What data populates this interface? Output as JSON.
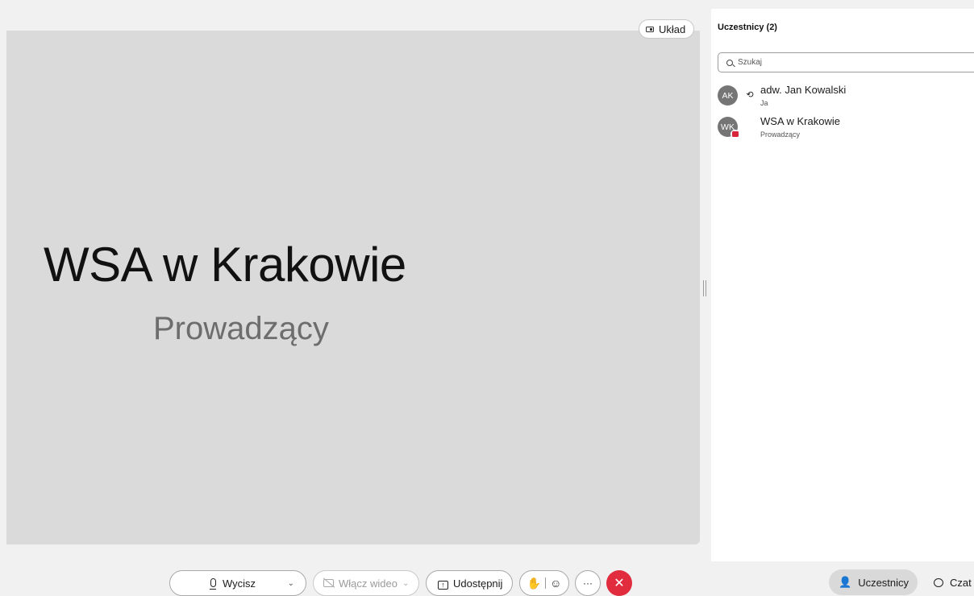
{
  "stage": {
    "layout_button_label": "Układ",
    "speaker_name": "WSA w Krakowie",
    "speaker_role": "Prowadzący"
  },
  "panel": {
    "title": "Uczestnicy (2)",
    "search_placeholder": "Szukaj",
    "participants": [
      {
        "initials": "AK",
        "name": "adw. Jan Kowalski",
        "subtitle": "Ja"
      },
      {
        "initials": "WK",
        "name": "WSA w Krakowie",
        "subtitle": "Prowadzący"
      }
    ]
  },
  "controls": {
    "mute_label": "Wycisz",
    "video_label": "Włącz wideo",
    "share_label": "Udostępnij",
    "more_label": "···",
    "leave_label": "✕"
  },
  "tabs": {
    "participants_label": "Uczestnicy",
    "chat_label": "Czat"
  },
  "colors": {
    "leave_red": "#e12c3d",
    "stage_bg": "#dadada",
    "avatar_bg": "#757575"
  }
}
